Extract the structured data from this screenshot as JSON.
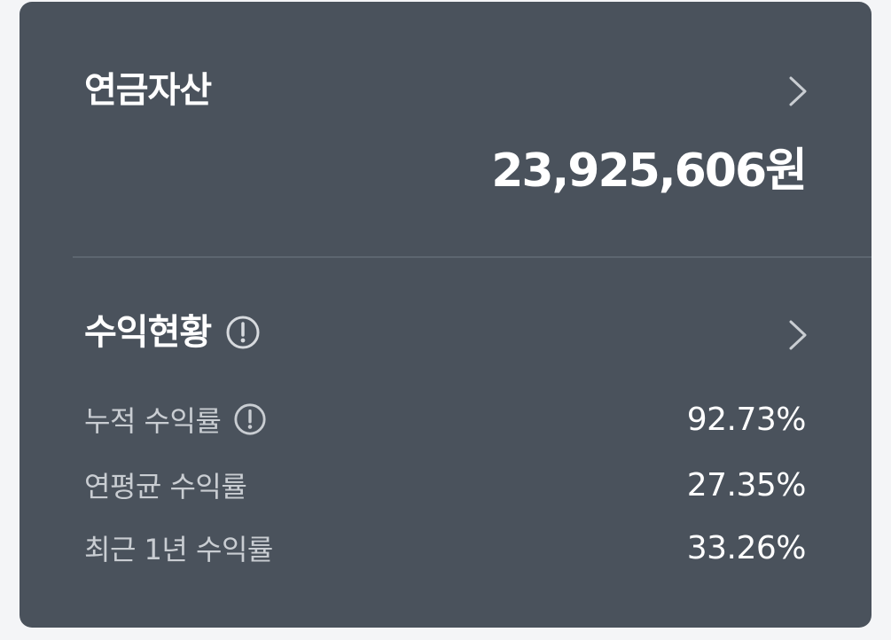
{
  "pension_assets": {
    "title": "연금자산",
    "amount": "23,925,606원"
  },
  "returns_status": {
    "title": "수익현황",
    "rows": [
      {
        "label": "누적 수익률",
        "value": "92.73%",
        "has_info": true
      },
      {
        "label": "연평균 수익률",
        "value": "27.35%",
        "has_info": false
      },
      {
        "label": "최근 1년 수익률",
        "value": "33.26%",
        "has_info": false
      }
    ]
  },
  "icons": {
    "chevron": "chevron-right-icon",
    "info": "info-circle-icon"
  },
  "colors": {
    "card_background": "#4a525c",
    "page_background": "#f4f5f7",
    "primary_text": "#ffffff",
    "secondary_text": "#c9cdd2"
  }
}
